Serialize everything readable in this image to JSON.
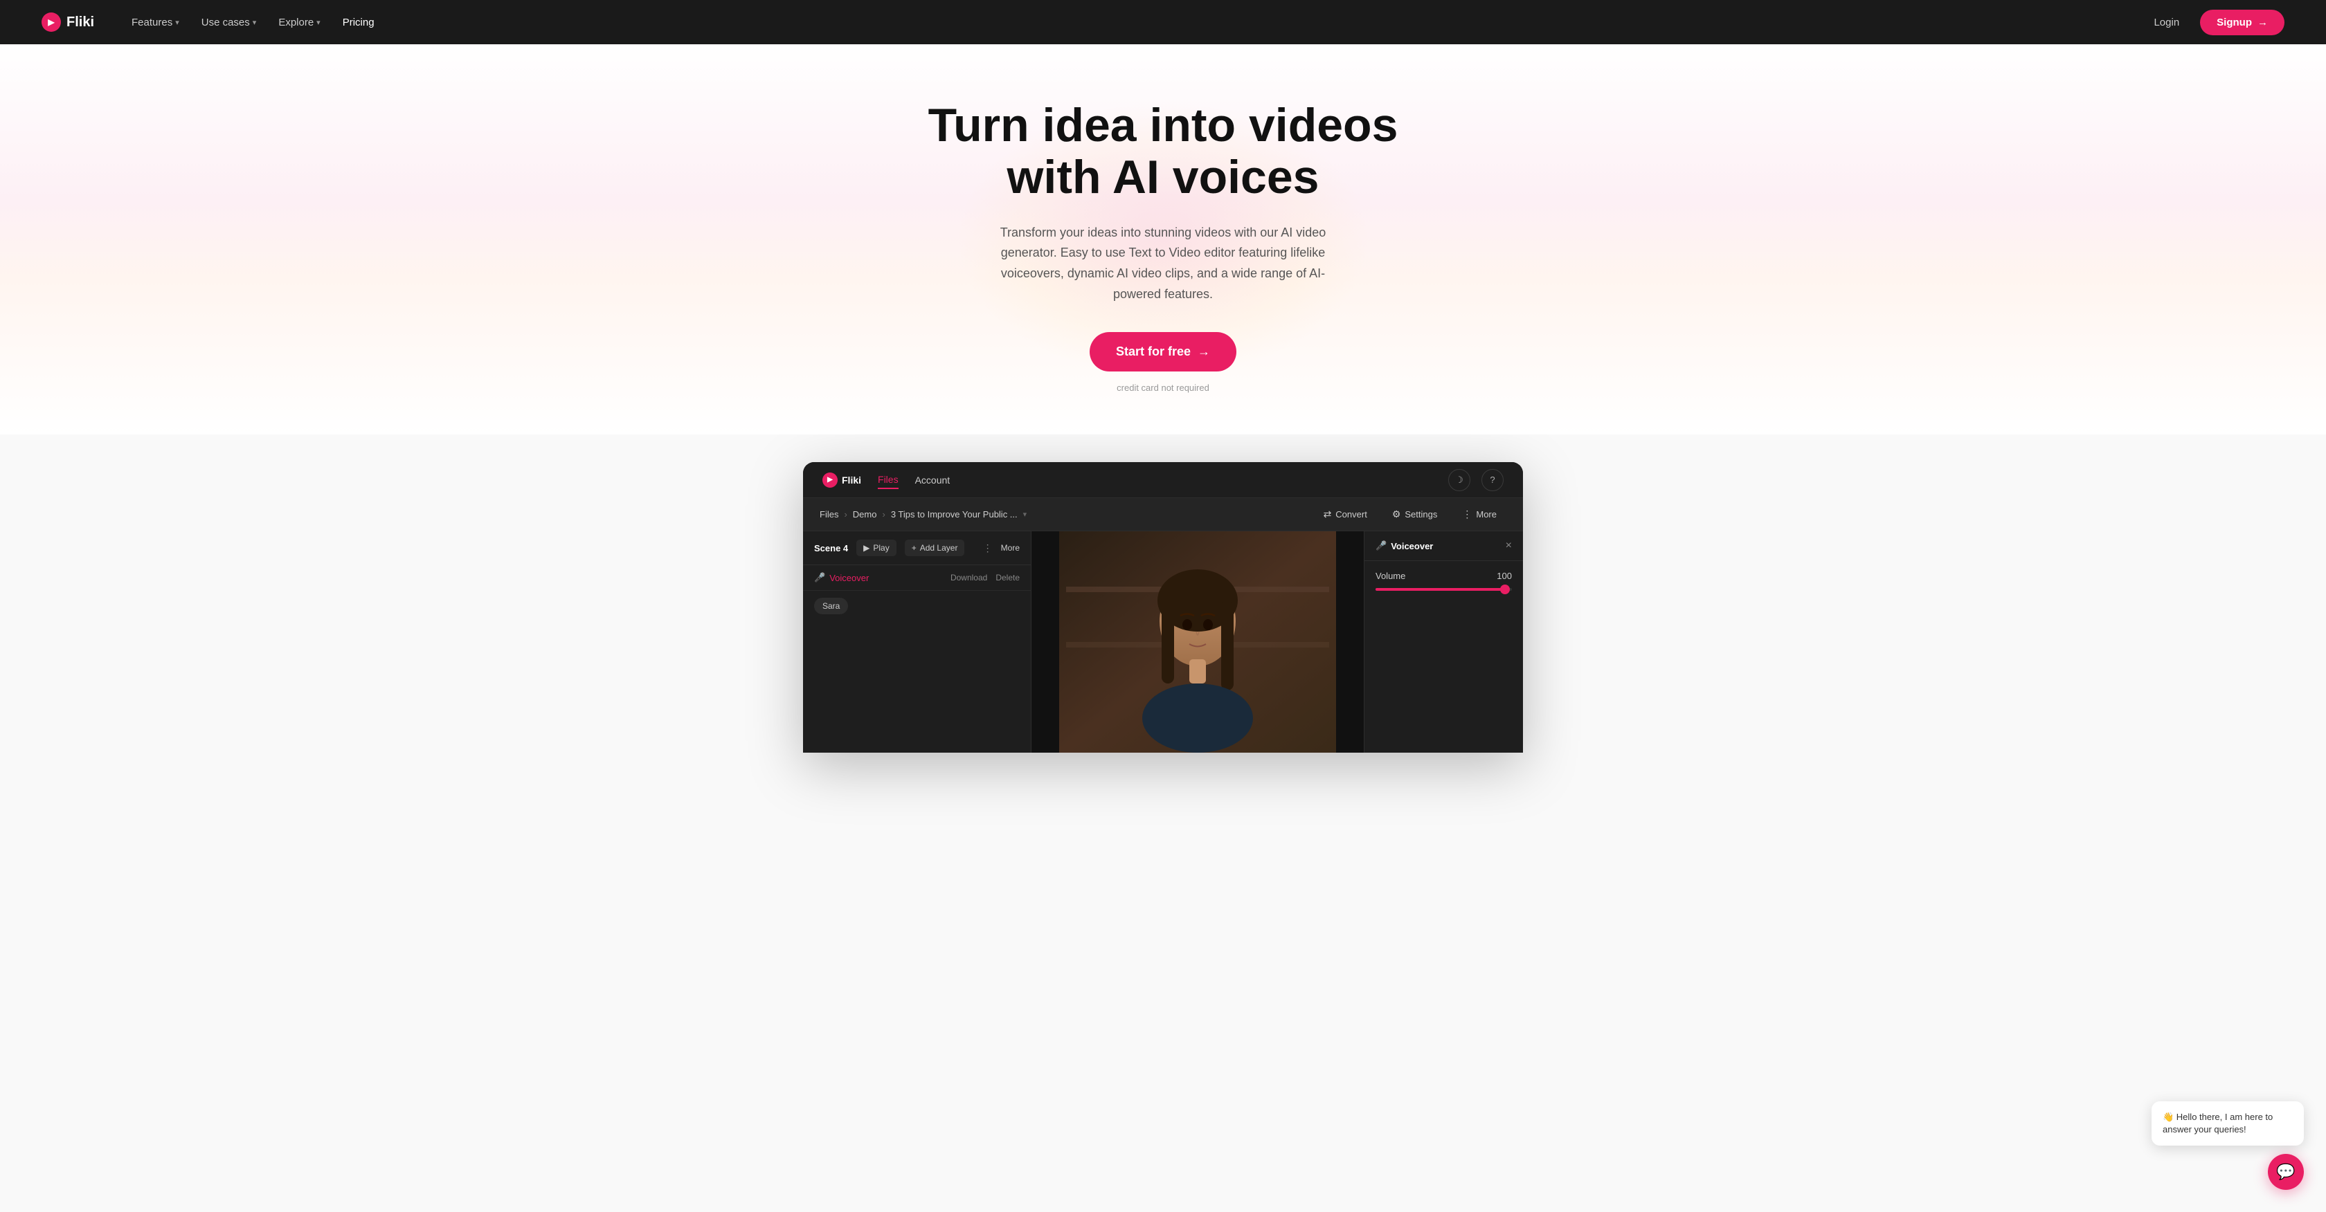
{
  "brand": {
    "name": "Fliki",
    "logo_text": "▶",
    "tagline": "Turn idea into videos\nwith AI voices"
  },
  "navbar": {
    "logo": "Fliki",
    "logo_icon": "▶",
    "menu_items": [
      {
        "label": "Features",
        "has_dropdown": true
      },
      {
        "label": "Use cases",
        "has_dropdown": true
      },
      {
        "label": "Explore",
        "has_dropdown": true
      },
      {
        "label": "Pricing",
        "has_dropdown": false
      }
    ],
    "login_label": "Login",
    "signup_label": "Signup",
    "signup_arrow": "→"
  },
  "hero": {
    "title_line1": "Turn idea into videos",
    "title_line2": "with AI voices",
    "subtitle": "Transform your ideas into stunning videos with our AI video generator. Easy to use Text to Video editor featuring lifelike voiceovers, dynamic AI video clips, and a wide range of AI-powered features.",
    "cta_label": "Start for free",
    "cta_arrow": "→",
    "note": "credit card not required"
  },
  "app_preview": {
    "topbar": {
      "logo": "Fliki",
      "logo_icon": "▶",
      "tabs": [
        {
          "label": "Files",
          "active": true
        },
        {
          "label": "Account",
          "active": false
        }
      ],
      "moon_icon": "☽",
      "help_icon": "?"
    },
    "breadcrumb": {
      "paths": [
        "Files",
        "Demo",
        "3 Tips to Improve Your Public ..."
      ],
      "dropdown_icon": "▾",
      "convert_label": "Convert",
      "convert_icon": "⇄",
      "settings_label": "Settings",
      "settings_icon": "⚙",
      "more_label": "More",
      "more_icon": "⋮"
    },
    "left_panel": {
      "scene_label": "Scene 4",
      "play_label": "Play",
      "play_icon": "▶",
      "add_layer_label": "Add Layer",
      "add_layer_icon": "+",
      "more_label": "More",
      "more_icon": "⋮",
      "voiceover_label": "Voiceover",
      "voiceover_icon": "🎤",
      "download_label": "Download",
      "delete_label": "Delete",
      "sara_label": "Sara"
    },
    "right_panel": {
      "title": "Voiceover",
      "title_icon": "🎤",
      "close_icon": "×",
      "volume_label": "Volume",
      "volume_value": "100"
    },
    "chat": {
      "bubble_text": "👋 Hello there, I am here to answer your queries!",
      "chat_icon": "💬"
    }
  }
}
